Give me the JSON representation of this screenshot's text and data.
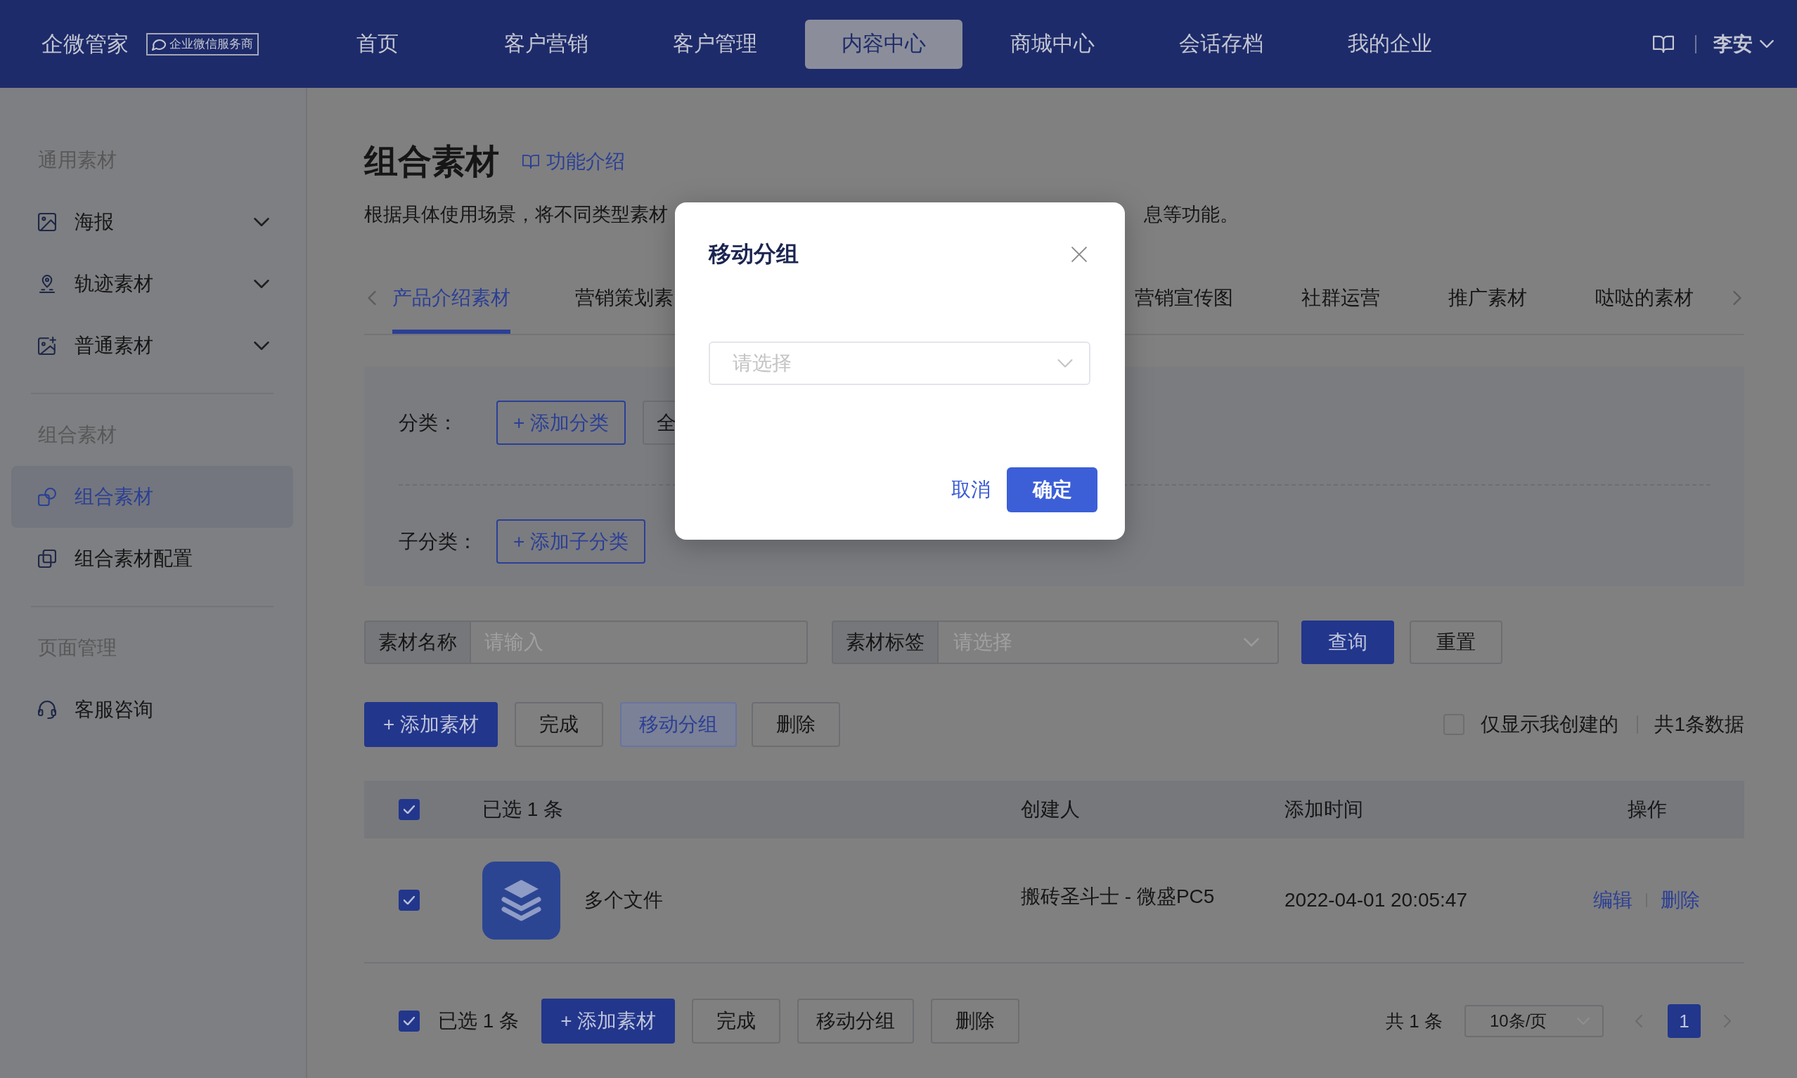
{
  "header": {
    "logo": "企微管家",
    "badge": "企业微信服务商",
    "nav": [
      {
        "label": "首页",
        "selected": false
      },
      {
        "label": "客户营销",
        "selected": false
      },
      {
        "label": "客户管理",
        "selected": false
      },
      {
        "label": "内容中心",
        "selected": true
      },
      {
        "label": "商城中心",
        "selected": false
      },
      {
        "label": "会话存档",
        "selected": false
      },
      {
        "label": "我的企业",
        "selected": false
      }
    ],
    "user": "李安"
  },
  "sidebar": {
    "sections": [
      {
        "title": "通用素材",
        "items": [
          {
            "label": "海报",
            "selected": false,
            "expanded": false
          },
          {
            "label": "轨迹素材",
            "selected": false,
            "expanded": false
          },
          {
            "label": "普通素材",
            "selected": false,
            "expanded": false
          }
        ]
      },
      {
        "title": "组合素材",
        "items": [
          {
            "label": "组合素材",
            "selected": true
          },
          {
            "label": "组合素材配置",
            "selected": false
          }
        ]
      },
      {
        "title": "页面管理",
        "items": [
          {
            "label": "客服咨询",
            "selected": false
          }
        ]
      }
    ]
  },
  "page": {
    "title": "组合素材",
    "help_link": "功能介绍",
    "description": {
      "left": "根据具体使用场景，将不同类型素材",
      "right": "息等功能。"
    },
    "tabs": {
      "left": [
        {
          "label": "产品介绍素材",
          "selected": true
        },
        {
          "label": "营销策划素",
          "selected": false
        }
      ],
      "right": [
        {
          "label": "营销宣传图",
          "selected": false
        },
        {
          "label": "社群运营",
          "selected": false
        },
        {
          "label": "推广素材",
          "selected": false
        },
        {
          "label": "哒哒的素材",
          "selected": false
        }
      ]
    },
    "filters": [
      {
        "label": "分类：",
        "buttons": [
          {
            "label": "+ 添加分类",
            "kind": "add"
          },
          {
            "label": "全",
            "kind": "option"
          }
        ]
      },
      {
        "label": "子分类：",
        "buttons": [
          {
            "label": "+ 添加子分类",
            "kind": "add"
          }
        ]
      }
    ],
    "search": {
      "fields": [
        {
          "label": "素材名称",
          "placeholder": "请输入",
          "kind": "input"
        },
        {
          "label": "素材标签",
          "placeholder": "请选择",
          "kind": "select"
        }
      ],
      "buttons": [
        {
          "label": "查询",
          "kind": "primary"
        },
        {
          "label": "重置",
          "kind": "default"
        }
      ]
    },
    "toolbar": {
      "buttons": [
        {
          "label": "+ 添加素材",
          "kind": "primary"
        },
        {
          "label": "完成",
          "kind": "default"
        },
        {
          "label": "移动分组",
          "kind": "highlighted"
        },
        {
          "label": "删除",
          "kind": "default"
        }
      ],
      "only_mine": {
        "label": "仅显示我创建的",
        "checked": false
      },
      "total": "共1条数据"
    },
    "table": {
      "select_all": {
        "checked": true
      },
      "columns": [
        "已选 1 条",
        "创建人",
        "添加时间",
        "操作"
      ],
      "rows": [
        {
          "checked": true,
          "name": "多个文件",
          "creator": "搬砖圣斗士 - 微盛PC5",
          "added": "2022-04-01 20:05:47",
          "actions": [
            "编辑",
            "删除"
          ]
        }
      ]
    },
    "footer": {
      "select_all": {
        "checked": true
      },
      "selected_count": "已选 1 条",
      "buttons": [
        {
          "label": "+ 添加素材",
          "kind": "primary"
        },
        {
          "label": "完成",
          "kind": "default"
        },
        {
          "label": "移动分组",
          "kind": "default"
        },
        {
          "label": "删除",
          "kind": "default"
        }
      ],
      "total": "共 1 条",
      "page_size": "10条/页",
      "pages": [
        {
          "label": "1",
          "selected": true
        }
      ]
    }
  },
  "dialog": {
    "title": "移动分组",
    "select": {
      "placeholder": "请选择"
    },
    "buttons": [
      {
        "label": "取消",
        "kind": "text"
      },
      {
        "label": "确定",
        "kind": "primary"
      }
    ]
  }
}
